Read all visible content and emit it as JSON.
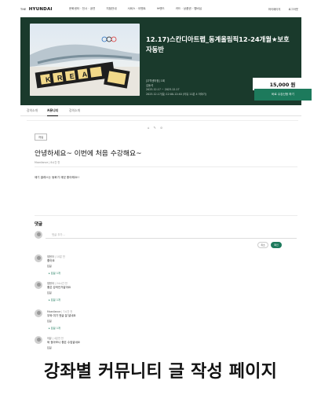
{
  "nav": {
    "logo_small": "THE",
    "logo": "HYUNDAI",
    "links": [
      "문화센터 · 전시 · 공연",
      "지점안내",
      "서비스 · 이벤트",
      "브랜드",
      "카드 · 상품권 · 멤버십"
    ],
    "right": [
      "마이페이지",
      "로그아웃"
    ]
  },
  "hero": {
    "title": "12.17)스칸디아트랩_동계올림픽12-24개월★보호자동반",
    "meta": [
      "[무역센터점] 1회",
      "김동석",
      "2023.12.17 ~ 2023.12.17",
      "2023.12.17(일) 12:00-12:40 (이유 11분 4 이야기)"
    ],
    "price": "15,000 원",
    "enroll": "바로 수강신청 하기",
    "image_letters": "KOREA"
  },
  "tabs": [
    "강의소개",
    "커뮤니티",
    "강의소개"
  ],
  "post": {
    "toolbar": [
      "⌂",
      "✎",
      "⊘"
    ],
    "badge": "자유",
    "title": "안녕하세요~ 이번에 처음 수강해요~",
    "author": "Maedlance | 8시간 전",
    "body": "애기 클래스는 동화가 재밌 좋아해요!!"
  },
  "comments": {
    "heading": "댓글",
    "placeholder": "댓글 추가...",
    "cancel": "취소",
    "submit": "확인",
    "items": [
      {
        "author": "정현아",
        "time": "| 10분 전",
        "text": "좋아요",
        "reply": "답글",
        "count": "▸ 답글 1개"
      },
      {
        "author": "정현아",
        "time": "| 24시간 전",
        "text": "좋은 강의인거같아요",
        "reply": "답글",
        "count": "▸ 답글 1개"
      },
      {
        "author": "Maedlance",
        "time": "| 7시간 전",
        "text": "우와 여기 댓글 잘 달네요",
        "reply": "답글",
        "count": "▸ 답글 1개"
      },
      {
        "author": "이유",
        "time": "| 4분전 전",
        "text": "와 찾아보니 좋은 수업같네요",
        "reply": "답글",
        "count": ""
      }
    ]
  },
  "caption": "강좌별 커뮤니티 글 작성 페이지",
  "colors": {
    "hero_bg": "#1a3a2c",
    "accent": "#1d7a5c"
  }
}
